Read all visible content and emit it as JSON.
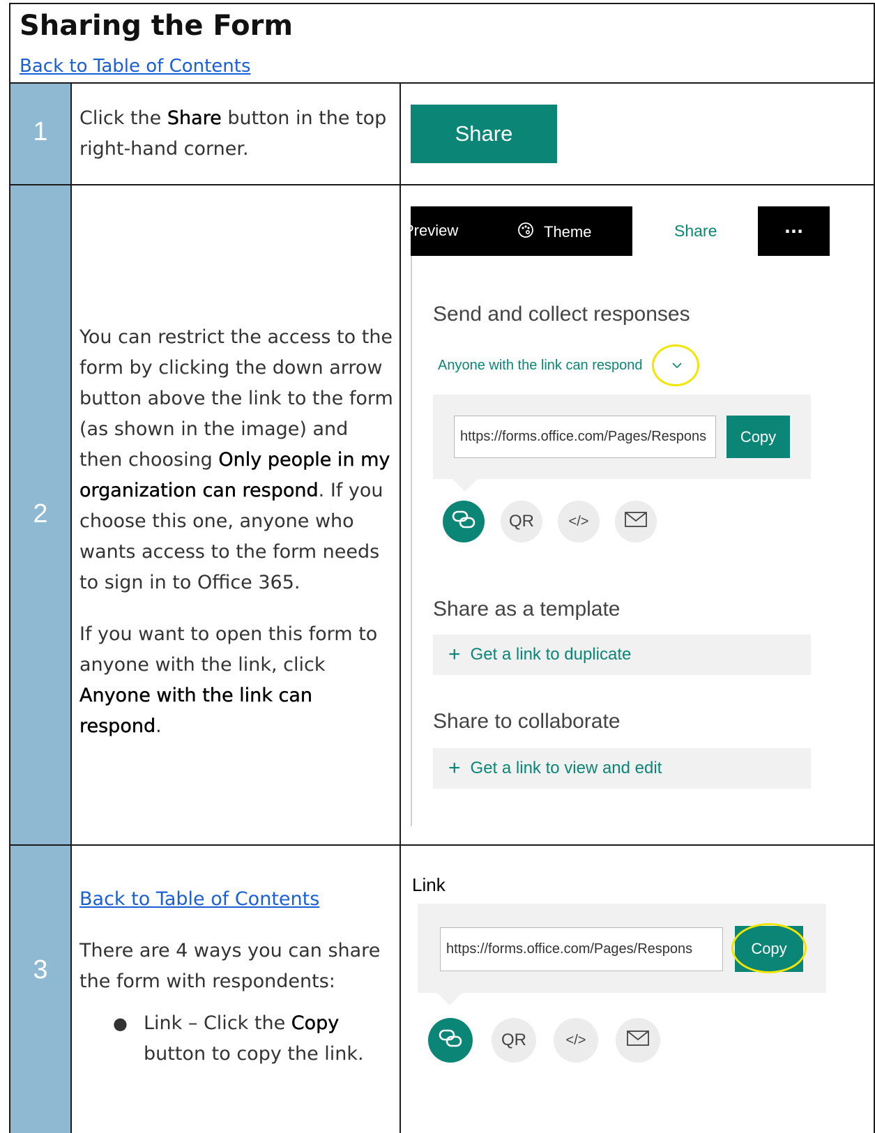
{
  "header": {
    "title": "Sharing the Form",
    "toc_link": "Back to Table of Contents"
  },
  "steps": [
    {
      "number": "1",
      "text_a": "Click the ",
      "text_b": "Share",
      "text_c": " button in the top right-hand corner.",
      "button_label": "Share"
    },
    {
      "number": "2",
      "p1_a": "You can restrict the access to the form by clicking the down arrow button above the link to the form (as shown in the image) and then choosing ",
      "p1_b": "Only people in my organization can respond",
      "p1_c": ". If you choose this one, anyone who wants access to the form needs to sign in to Office 365.",
      "p2_a": "If you want to open this form to anyone with the link, click ",
      "p2_b": "Anyone with the link can respond",
      "p2_c": ".",
      "topbar": {
        "preview": "Preview",
        "theme": "Theme",
        "share": "Share",
        "more": "···"
      },
      "send_title": "Send and collect responses",
      "access_option": "Anyone with the link can respond",
      "url": "https://forms.office.com/Pages/Respons",
      "copy_label": "Copy",
      "icons": {
        "qr": "QR",
        "embed": "</>"
      },
      "template_title": "Share as a template",
      "duplicate_link": "Get a link to duplicate",
      "collab_title": "Share to collaborate",
      "view_edit_link": "Get a link to view and edit"
    },
    {
      "number": "3",
      "toc_link": "Back to Table of Contents",
      "intro": "There are 4 ways you can share the form with respondents:",
      "bullet_a": "Link – Click the ",
      "bullet_b": "Copy",
      "bullet_c": " button to copy the link.",
      "panel_label": "Link",
      "url": "https://forms.office.com/Pages/Respons",
      "copy_label": "Copy",
      "icons": {
        "qr": "QR",
        "embed": "</>"
      }
    }
  ],
  "colors": {
    "accent": "#0b8575",
    "step_column": "#8fb8d3",
    "link": "#1a5fd6",
    "highlight": "#f2e500"
  }
}
